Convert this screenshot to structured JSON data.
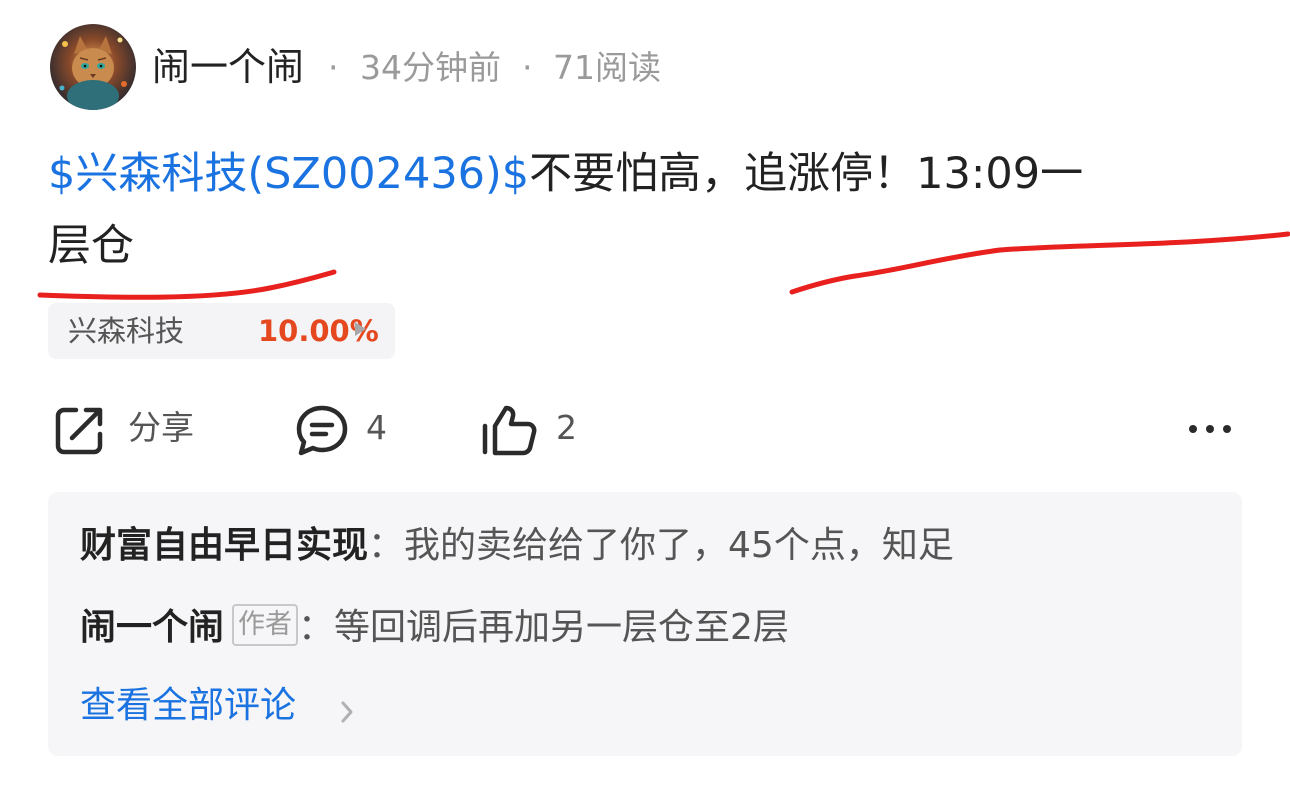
{
  "post": {
    "author": "闹一个闹",
    "separator": "·",
    "time_ago": "34分钟前",
    "reads": "71阅读",
    "stock_link": "$兴森科技(SZ002436)$",
    "text_line1": "不要怕高，追涨停！13:09一",
    "text_line2": "层仓",
    "avatar_icon": "cat-avatar-icon"
  },
  "stock_chip": {
    "name": "兴森科技",
    "change": "10.00%",
    "change_color": "#e5481f"
  },
  "actions": {
    "share_label": "分享",
    "comment_count": "4",
    "like_count": "2",
    "share_icon": "share-icon",
    "comment_icon": "comment-icon",
    "like_icon": "thumbs-up-icon",
    "more_icon": "more-icon"
  },
  "comments": {
    "items": [
      {
        "user": "财富自由早日实现",
        "colon": "：",
        "text": "我的卖给给了你了，45个点，知足"
      },
      {
        "user": "闹一个闹",
        "tag": "作者",
        "colon": "：",
        "text": "等回调后再加另一层仓至2层"
      }
    ],
    "view_all": "查看全部评论"
  },
  "colors": {
    "link_blue": "#1a73e0",
    "annotation_red": "#e8201e",
    "text_dark": "#222222",
    "text_grey": "#9a9a9a"
  }
}
